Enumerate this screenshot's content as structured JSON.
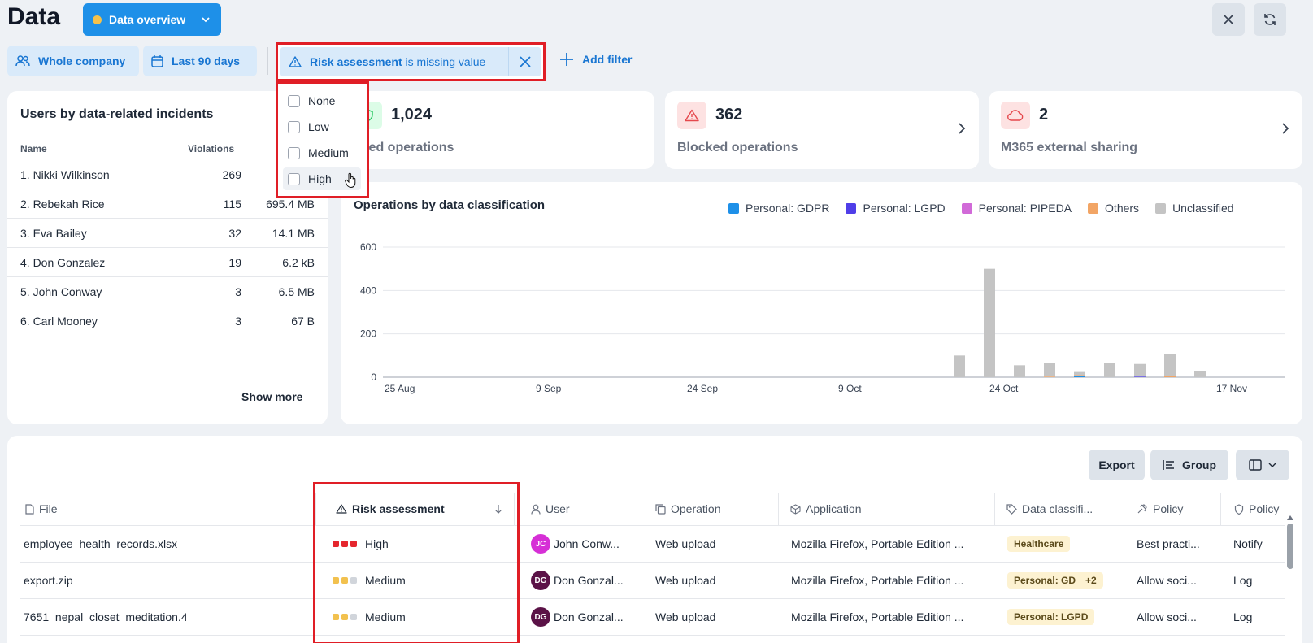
{
  "header": {
    "title": "Data",
    "overview_label": "Data overview"
  },
  "filters": {
    "company": "Whole company",
    "period": "Last 90 days",
    "active_filter_field": "Risk assessment",
    "active_filter_op": "is missing value",
    "add_filter": "Add filter"
  },
  "dropdown": {
    "options": [
      "None",
      "Low",
      "Medium",
      "High"
    ]
  },
  "incidents": {
    "title": "Users by data-related incidents",
    "col_name": "Name",
    "col_violations": "Violations",
    "rows": [
      {
        "name": "1. Nikki Wilkinson",
        "violations": "269",
        "size": ""
      },
      {
        "name": "2. Rebekah Rice",
        "violations": "115",
        "size": "695.4 MB"
      },
      {
        "name": "3. Eva Bailey",
        "violations": "32",
        "size": "14.1 MB"
      },
      {
        "name": "4. Don Gonzalez",
        "violations": "19",
        "size": "6.2 kB"
      },
      {
        "name": "5. John Conway",
        "violations": "3",
        "size": "6.5 MB"
      },
      {
        "name": "6. Carl Mooney",
        "violations": "3",
        "size": "67 B"
      }
    ],
    "show_more": "Show more"
  },
  "stats": [
    {
      "value": "1,024",
      "label": "Audited operations",
      "visible_label": "dited operations",
      "icon": "shield-icon",
      "color": "#22c55e"
    },
    {
      "value": "362",
      "label": "Blocked operations",
      "icon": "warning-icon",
      "color": "#e5484d"
    },
    {
      "value": "2",
      "label": "M365 external sharing",
      "icon": "cloud-icon",
      "color": "#e5484d"
    }
  ],
  "chart_title": "Operations by data classification",
  "chart_data": {
    "type": "bar",
    "stacked": true,
    "title": "Operations by data classification",
    "x_tick_labels": [
      "25 Aug",
      "9 Sep",
      "24 Sep",
      "9 Oct",
      "24 Oct",
      "17 Nov"
    ],
    "y_ticks": [
      0,
      200,
      400,
      600
    ],
    "ylim": [
      0,
      600
    ],
    "grid": true,
    "legend_position": "top-right",
    "series": [
      {
        "name": "Personal: GDPR",
        "color": "#1e90e8"
      },
      {
        "name": "Personal: LGPD",
        "color": "#4f3ee8"
      },
      {
        "name": "Personal: PIPEDA",
        "color": "#d16ad8"
      },
      {
        "name": "Others",
        "color": "#f2a565"
      },
      {
        "name": "Unclassified",
        "color": "#c4c4c4"
      }
    ],
    "bars": [
      {
        "x": "20 Oct",
        "Unclassified": 100
      },
      {
        "x": "23 Oct",
        "Unclassified": 500
      },
      {
        "x": "26 Oct",
        "Unclassified": 55
      },
      {
        "x": "29 Oct",
        "Unclassified": 62,
        "Others": 3
      },
      {
        "x": "1 Nov",
        "Unclassified": 14,
        "Others": 6,
        "Personal: GDPR": 4
      },
      {
        "x": "4 Nov",
        "Unclassified": 65
      },
      {
        "x": "7 Nov",
        "Unclassified": 58,
        "Personal: LGPD": 3
      },
      {
        "x": "10 Nov",
        "Unclassified": 102,
        "Others": 4
      },
      {
        "x": "13 Nov",
        "Unclassified": 28
      }
    ]
  },
  "table": {
    "export": "Export",
    "group": "Group",
    "columns": [
      "File",
      "Risk assessment",
      "User",
      "Operation",
      "Application",
      "Data classifi...",
      "Policy",
      "Policy"
    ],
    "rows": [
      {
        "file": "employee_health_records.xlsx",
        "risk": "High",
        "risk_level": 3,
        "initials": "JC",
        "avatar_color": "#d62fd6",
        "user": "John Conw...",
        "operation": "Web upload",
        "application": "Mozilla Firefox, Portable Edition ...",
        "classification": "Healthcare",
        "extra": "",
        "policy": "Best practi...",
        "action": "Notify"
      },
      {
        "file": "export.zip",
        "risk": "Medium",
        "risk_level": 2,
        "initials": "DG",
        "avatar_color": "#5b1247",
        "user": "Don Gonzal...",
        "operation": "Web upload",
        "application": "Mozilla Firefox, Portable Edition ...",
        "classification": "Personal: GD",
        "extra": "+2",
        "policy": "Allow soci...",
        "action": "Log"
      },
      {
        "file": "7651_nepal_closet_meditation.4",
        "risk": "Medium",
        "risk_level": 2,
        "initials": "DG",
        "avatar_color": "#5b1247",
        "user": "Don Gonzal...",
        "operation": "Web upload",
        "application": "Mozilla Firefox, Portable Edition ...",
        "classification": "Personal: LGPD",
        "extra": "",
        "policy": "Allow soci...",
        "action": "Log"
      }
    ]
  }
}
